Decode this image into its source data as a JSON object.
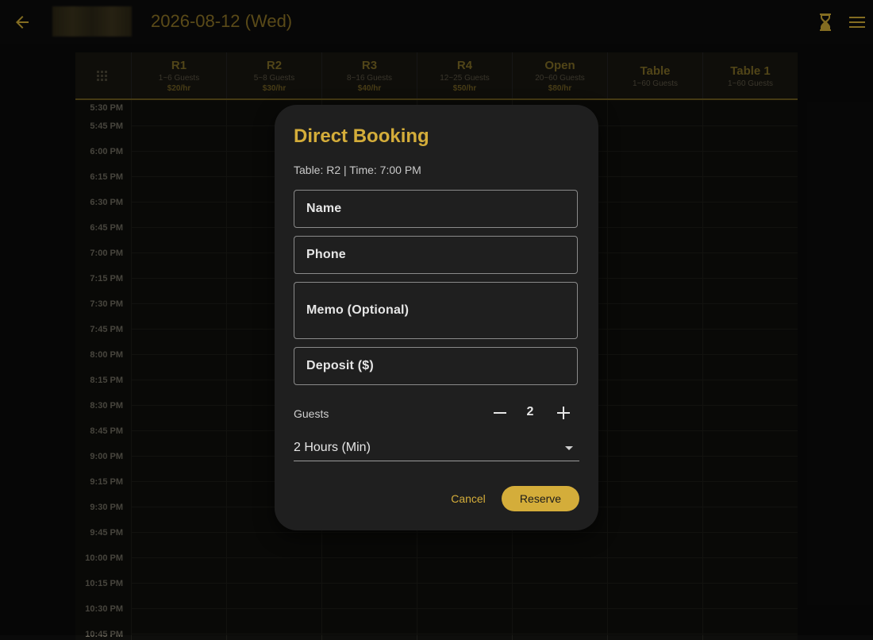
{
  "header": {
    "date": "2026-08-12 (Wed)"
  },
  "columns": [
    {
      "name": "R1",
      "guests": "1~6 Guests",
      "price": "$20/hr"
    },
    {
      "name": "R2",
      "guests": "5~8 Guests",
      "price": "$30/hr"
    },
    {
      "name": "R3",
      "guests": "8~16 Guests",
      "price": "$40/hr"
    },
    {
      "name": "R4",
      "guests": "12~25 Guests",
      "price": "$50/hr"
    },
    {
      "name": "Open",
      "guests": "20~60 Guests",
      "price": "$80/hr"
    },
    {
      "name": "Table",
      "guests": "1~60 Guests"
    },
    {
      "name": "Table 1",
      "guests": "1~60 Guests"
    }
  ],
  "times": [
    "5:30 PM",
    "5:45 PM",
    "6:00 PM",
    "6:15 PM",
    "6:30 PM",
    "6:45 PM",
    "7:00 PM",
    "7:15 PM",
    "7:30 PM",
    "7:45 PM",
    "8:00 PM",
    "8:15 PM",
    "8:30 PM",
    "8:45 PM",
    "9:00 PM",
    "9:15 PM",
    "9:30 PM",
    "9:45 PM",
    "10:00 PM",
    "10:15 PM",
    "10:30 PM",
    "10:45 PM"
  ],
  "dialog": {
    "title": "Direct Booking",
    "subtitle": "Table: R2 | Time: 7:00 PM",
    "fields": {
      "name": "Name",
      "phone": "Phone",
      "memo": "Memo (Optional)",
      "deposit": "Deposit ($)"
    },
    "guests_label": "Guests",
    "guests_value": "2",
    "duration": "2 Hours (Min)",
    "cancel": "Cancel",
    "reserve": "Reserve"
  },
  "icons": {
    "back": "back-arrow-icon",
    "hourglass": "hourglass-icon",
    "menu": "menu-icon",
    "grid": "grid-icon",
    "minus": "minus-icon",
    "plus": "plus-icon",
    "caret": "dropdown-caret-icon"
  },
  "colors": {
    "accent": "#d4ad3a",
    "background": "#0a0a0a",
    "dialog": "#1f1f1f"
  }
}
